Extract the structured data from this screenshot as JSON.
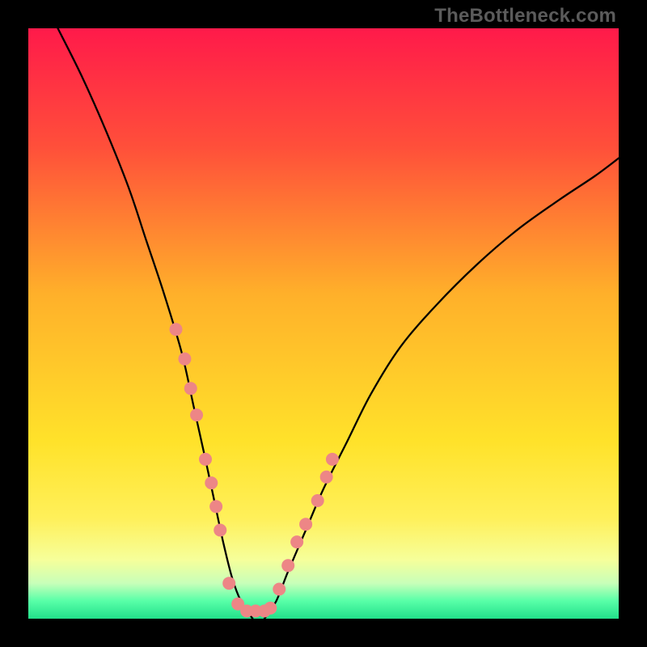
{
  "watermark": "TheBottleneck.com",
  "chart_data": {
    "type": "line",
    "title": "",
    "xlabel": "",
    "ylabel": "",
    "xlim": [
      0,
      100
    ],
    "ylim": [
      0,
      100
    ],
    "grid": false,
    "legend": false,
    "background_gradient_stops": [
      {
        "pct": 0,
        "color": "#ff1a4a"
      },
      {
        "pct": 20,
        "color": "#ff4f3a"
      },
      {
        "pct": 45,
        "color": "#ffb02a"
      },
      {
        "pct": 70,
        "color": "#ffe22a"
      },
      {
        "pct": 83,
        "color": "#fff05a"
      },
      {
        "pct": 90,
        "color": "#f6ff9a"
      },
      {
        "pct": 94,
        "color": "#c8ffb9"
      },
      {
        "pct": 97,
        "color": "#58ffa8"
      },
      {
        "pct": 100,
        "color": "#22e08a"
      }
    ],
    "series": [
      {
        "name": "left-branch",
        "x": [
          5,
          9,
          13,
          17,
          20,
          23,
          26,
          28,
          30,
          31.5,
          33,
          34.5,
          36,
          38
        ],
        "y": [
          100,
          92,
          83,
          73,
          64,
          55,
          45,
          36,
          27,
          20,
          13,
          7,
          3,
          0
        ],
        "stroke": "#000000",
        "stroke_width": 2.3
      },
      {
        "name": "right-branch",
        "x": [
          40,
          42,
          44,
          47,
          50,
          54,
          58,
          63,
          69,
          76,
          83,
          90,
          96,
          100
        ],
        "y": [
          0,
          3,
          8,
          15,
          22,
          30,
          38,
          46,
          53,
          60,
          66,
          71,
          75,
          78
        ],
        "stroke": "#000000",
        "stroke_width": 2.3
      }
    ],
    "points": {
      "name": "highlighted-points",
      "color": "#ed8686",
      "radius": 8,
      "x": [
        25,
        26.5,
        27.5,
        28.5,
        30,
        31,
        31.8,
        32.5,
        34,
        35.5,
        37,
        38.5,
        40,
        41,
        42.5,
        44,
        45.5,
        47,
        49,
        50.5,
        51.5
      ],
      "y": [
        49,
        44,
        39,
        34.5,
        27,
        23,
        19,
        15,
        6,
        2.5,
        1.3,
        1.3,
        1.3,
        1.8,
        5,
        9,
        13,
        16,
        20,
        24,
        27
      ]
    }
  }
}
